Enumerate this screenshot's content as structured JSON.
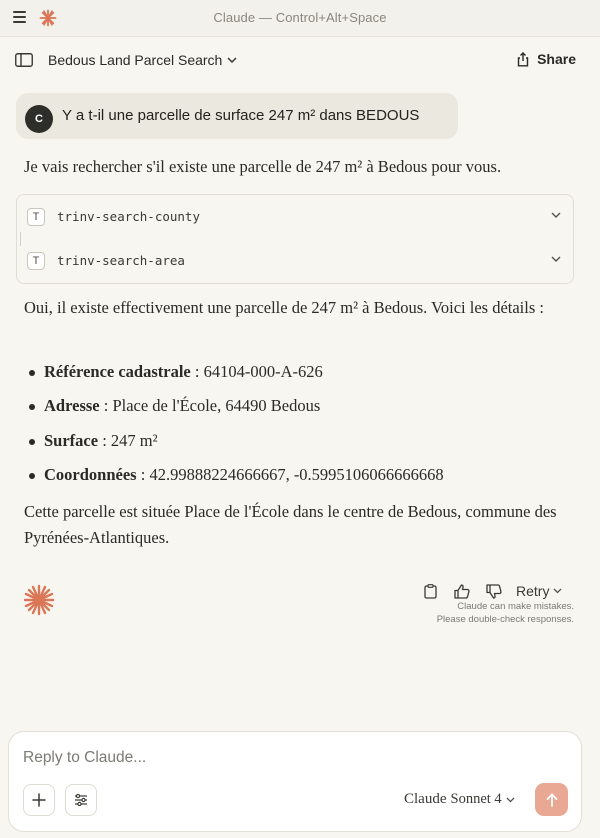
{
  "window": {
    "title": "Claude — Control+Alt+Space"
  },
  "header": {
    "conversation_title": "Bedous Land Parcel Search",
    "share_label": "Share"
  },
  "user_message": {
    "avatar_initial": "C",
    "text": "Y a t-il une parcelle de surface 247 m² dans BEDOUS"
  },
  "assistant": {
    "intro": "Je vais rechercher s'il existe une parcelle de 247 m² à Bedous pour vous.",
    "tools": [
      {
        "icon": "T",
        "name": "trinv-search-county"
      },
      {
        "icon": "T",
        "name": "trinv-search-area"
      }
    ],
    "summary": "Oui, il existe effectivement une parcelle de 247 m² à Bedous. Voici les détails :",
    "details": [
      {
        "label": "Référence cadastrale",
        "sep": " : ",
        "value": "64104-000-A-626"
      },
      {
        "label": "Adresse",
        "sep": " : ",
        "value": "Place de l'École, 64490 Bedous"
      },
      {
        "label": "Surface",
        "sep": " : ",
        "value": "247 m²"
      },
      {
        "label": "Coordonnées",
        "sep": " : ",
        "value": "42.99888224666667, -0.5995106066666668"
      }
    ],
    "closing": "Cette parcelle est située Place de l'École dans le centre de Bedous, commune des Pyrénées-Atlantiques."
  },
  "actions": {
    "retry_label": "Retry",
    "disclaimer_line1": "Claude can make mistakes.",
    "disclaimer_line2": "Please double-check responses."
  },
  "composer": {
    "placeholder": "Reply to Claude...",
    "model_brand": "Claude",
    "model_name": "Sonnet 4"
  },
  "colors": {
    "accent": "#d97757",
    "send_button": "#e9a894",
    "background": "#f8f6f1"
  }
}
